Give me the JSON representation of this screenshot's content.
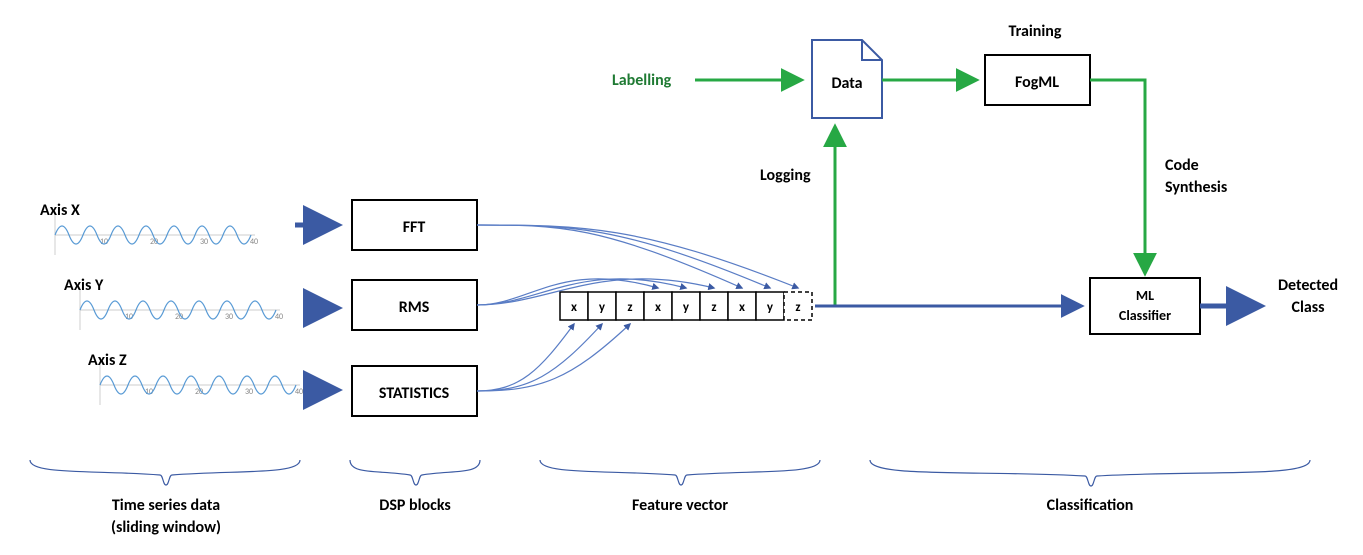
{
  "axes": {
    "x": "Axis X",
    "y": "Axis Y",
    "z": "Axis Z"
  },
  "dsp": {
    "fft": "FFT",
    "rms": "RMS",
    "stats": "STATISTICS"
  },
  "vector_cells": [
    "x",
    "y",
    "z",
    "x",
    "y",
    "z",
    "x",
    "y",
    "z"
  ],
  "top": {
    "labelling": "Labelling",
    "data": "Data",
    "training": "Training",
    "fogml": "FogML",
    "logging": "Logging",
    "code": "Code",
    "synthesis": "Synthesis"
  },
  "classifier": {
    "line1": "ML",
    "line2": "Classifier"
  },
  "output": {
    "line1": "Detected",
    "line2": "Class"
  },
  "sections": {
    "timeseries1": "Time series data",
    "timeseries2": "(sliding window)",
    "dsp": "DSP blocks",
    "feature": "Feature vector",
    "classification": "Classification"
  },
  "ticks": [
    "10",
    "20",
    "30",
    "40"
  ]
}
